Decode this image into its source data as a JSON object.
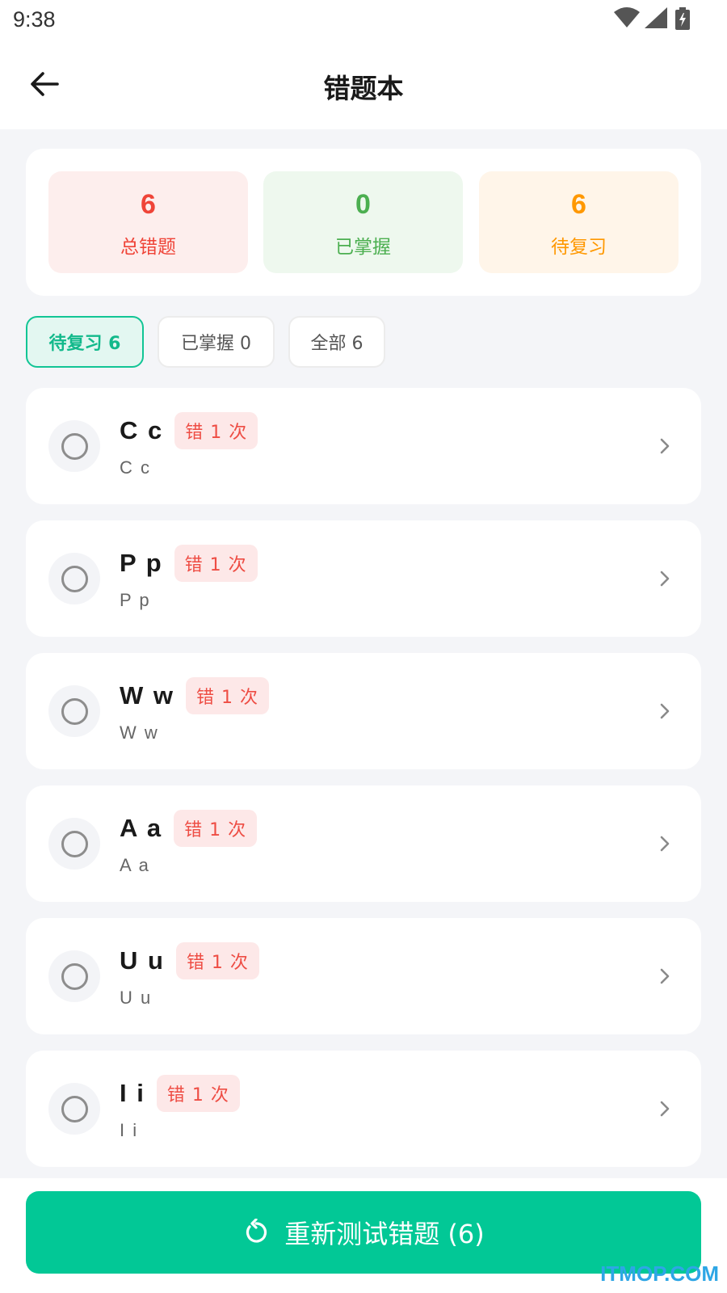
{
  "status_bar": {
    "time": "9:38",
    "icons": [
      "wifi-icon",
      "signal-icon",
      "battery-charging-icon"
    ]
  },
  "header": {
    "back_icon": "arrow-left-icon",
    "title": "错题本"
  },
  "stats": {
    "total": {
      "value": "6",
      "label": "总错题",
      "color": "#ef4438",
      "bg": "#fdeeed"
    },
    "mastered": {
      "value": "0",
      "label": "已掌握",
      "color": "#4caf50",
      "bg": "#eef8ee"
    },
    "pending": {
      "value": "6",
      "label": "待复习",
      "color": "#ff9800",
      "bg": "#fff5e9"
    }
  },
  "tabs": [
    {
      "label": "待复习 6",
      "active": true
    },
    {
      "label": "已掌握 0",
      "active": false
    },
    {
      "label": "全部 6",
      "active": false
    }
  ],
  "items": [
    {
      "title": "C c",
      "badge": "错 1 次",
      "subtitle": "C c"
    },
    {
      "title": "P p",
      "badge": "错 1 次",
      "subtitle": "P p"
    },
    {
      "title": "W w",
      "badge": "错 1 次",
      "subtitle": "W w"
    },
    {
      "title": "A a",
      "badge": "错 1 次",
      "subtitle": "A a"
    },
    {
      "title": "U u",
      "badge": "错 1 次",
      "subtitle": "U u"
    },
    {
      "title": "I i",
      "badge": "错 1 次",
      "subtitle": "I i"
    }
  ],
  "footer": {
    "retest_icon": "refresh-icon",
    "retest_label": "重新测试错题 (6)",
    "button_color": "#02c896"
  },
  "watermark": "ITMOP.COM"
}
